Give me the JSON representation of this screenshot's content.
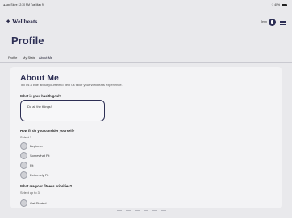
{
  "status_bar": {
    "left": "◂ App Store  12:30 PM  Tue May 9",
    "right": "⌔ 40%"
  },
  "header": {
    "logo": "✦ Wellbeats",
    "user": "Jenn"
  },
  "page": {
    "title": "Profile"
  },
  "tabs": [
    {
      "label": "Profile"
    },
    {
      "label": "My Stats"
    },
    {
      "label": "About Me"
    }
  ],
  "about": {
    "title": "About Me",
    "subtitle": "Tell us a little about yourself to help us tailor your Wellbeats experience."
  },
  "health_goal": {
    "question": "What is your health goal?",
    "value": "Do all the things!"
  },
  "fitness_level": {
    "question": "How fit do you consider yourself?",
    "helper": "Select 1",
    "options": [
      {
        "label": "Beginner"
      },
      {
        "label": "Somewhat Fit"
      },
      {
        "label": "Fit"
      },
      {
        "label": "Extremely Fit"
      }
    ]
  },
  "fitness_priorities": {
    "question": "What are your fitness priorities?",
    "helper": "Select up to 3",
    "options": [
      {
        "label": "Get Started"
      }
    ]
  }
}
